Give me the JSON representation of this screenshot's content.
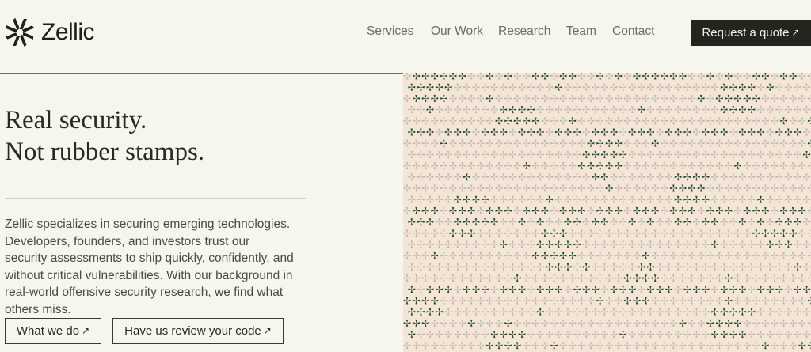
{
  "brand": {
    "name": "Zellic"
  },
  "nav": {
    "items": [
      {
        "label": "Services"
      },
      {
        "label": "Our Work"
      },
      {
        "label": "Research"
      },
      {
        "label": "Team"
      },
      {
        "label": "Contact"
      }
    ],
    "cta_label": "Request a quote",
    "cta_arrow": "↗"
  },
  "hero": {
    "title_line1": "Real security.",
    "title_line2": "Not rubber stamps.",
    "description": "Zellic specializes in securing emerging technologies. Developers, founders, and investors trust our security assessments to ship quickly, confidently, and without critical vulnerabilities. With our background in real-world offensive security research, we find what others miss.",
    "buttons": [
      {
        "label": "What we do",
        "arrow": "↗"
      },
      {
        "label": "Have us review your code",
        "arrow": "↗"
      }
    ]
  },
  "colors": {
    "background": "#f6f6ef",
    "cta_background": "#252520",
    "pattern_background": "#f5e5d7",
    "pattern_dark": "#1f4a2e",
    "pattern_light": "#bdb7ad"
  },
  "icons": {
    "logo": "zellic-pinwheel-logo-icon",
    "pattern_glyph": "pinwheel-icon",
    "arrow": "arrow-up-right-icon"
  }
}
